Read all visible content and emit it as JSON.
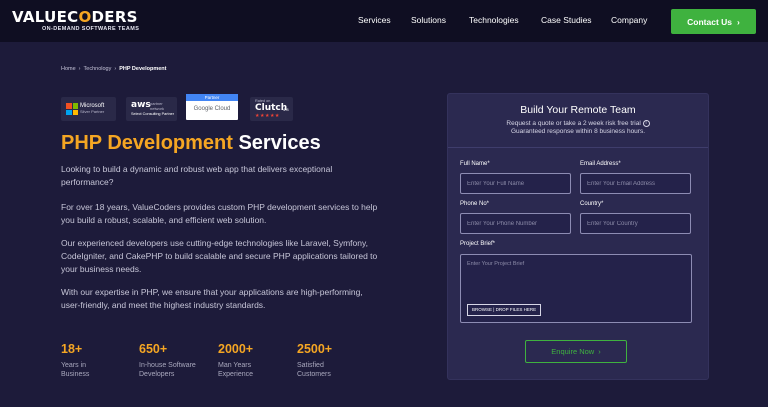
{
  "header": {
    "logo_prefix": "VALUE",
    "logo_o": "O",
    "logo_suffix": "CODERS",
    "logo_tagline": "ON-DEMAND SOFTWARE TEAMS",
    "nav": [
      "Services",
      "Solutions",
      "Technologies",
      "Case Studies",
      "Company"
    ],
    "cta_label": "Contact Us",
    "cta_icon": "chevron-right-icon"
  },
  "breadcrumb": {
    "items": [
      "Home",
      "Technology"
    ],
    "current": "PHP Development"
  },
  "badges": {
    "microsoft": {
      "line1": "Microsoft",
      "line2": "Silver Partner"
    },
    "aws": {
      "logo": "aws",
      "partner": "partner",
      "network": "network",
      "select": "Select Consulting Partner"
    },
    "google": {
      "top": "Partner",
      "name": "Google Cloud"
    },
    "clutch": {
      "rated": "Rated on",
      "name": "Clutch",
      "score": "4.8",
      "stars": "★★★★★"
    }
  },
  "hero": {
    "title_accent": "PHP Development",
    "title_rest": "Services",
    "paragraphs": [
      "Looking to build a dynamic and robust web app that delivers exceptional performance?",
      "For over 18 years, ValueCoders provides custom PHP development services to help you build a robust, scalable, and efficient web solution.",
      "Our experienced developers use cutting-edge technologies like Laravel, Symfony, CodeIgniter, and CakePHP to build scalable and secure PHP applications tailored to your business needs.",
      "With our expertise in PHP, we ensure that your applications are high-performing, user-friendly, and meet the highest industry standards."
    ]
  },
  "stats": [
    {
      "value": "18+",
      "label": "Years in Business"
    },
    {
      "value": "650+",
      "label": "In-house Software Developers"
    },
    {
      "value": "2000+",
      "label": "Man Years Experience"
    },
    {
      "value": "2500+",
      "label": "Satisfied Customers"
    }
  ],
  "form": {
    "title": "Build Your Remote Team",
    "subtitle_line1": "Request a quote or take a 2 week risk free trial",
    "subtitle_line2": "Guaranteed response within 8 business hours.",
    "info_icon": "i",
    "full_name": {
      "label": "Full Name*",
      "placeholder": "Enter Your Full Name",
      "value": ""
    },
    "email": {
      "label": "Email Address*",
      "placeholder": "Enter Your Email Address",
      "value": ""
    },
    "phone": {
      "label": "Phone No*",
      "placeholder": "Enter Your Phone Number",
      "value": ""
    },
    "country": {
      "label": "Country*",
      "placeholder": "Enter Your Country",
      "value": ""
    },
    "brief": {
      "label": "Project Brief*",
      "placeholder": "Enter Your Project Brief"
    },
    "browse_label": "BROWSE | DROP FILES HERE",
    "submit_label": "Enquire Now"
  },
  "colors": {
    "accent": "#f5a623",
    "cta_green": "#3fb23f",
    "background": "#1d1b3a",
    "header_bg": "#0f0e22",
    "card_bg": "#2b2950"
  }
}
